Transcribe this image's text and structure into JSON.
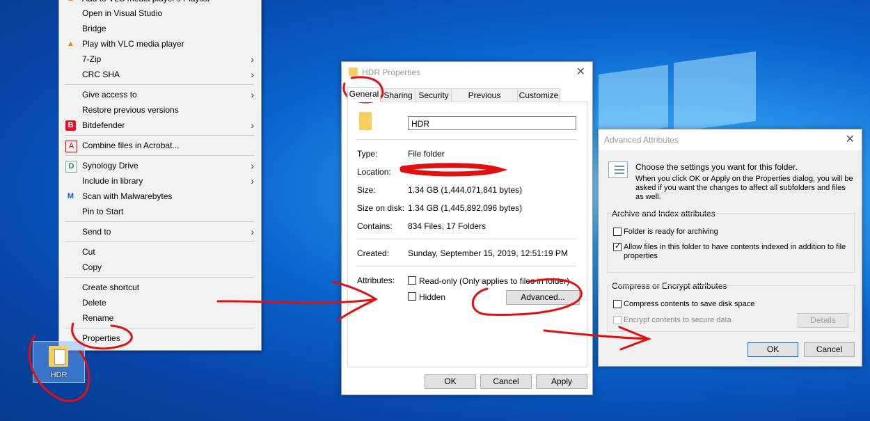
{
  "context_menu": {
    "items": [
      {
        "label": "Add to VLC media player's Playlist",
        "icon": "vlc-icon"
      },
      {
        "label": "Open in Visual Studio"
      },
      {
        "label": "Bridge"
      },
      {
        "label": "Play with VLC media player",
        "icon": "vlc-icon"
      },
      {
        "label": "7-Zip",
        "submenu": true
      },
      {
        "label": "CRC SHA",
        "submenu": true
      },
      {
        "label": "Give access to",
        "submenu": true
      },
      {
        "label": "Restore previous versions"
      },
      {
        "label": "Bitdefender",
        "submenu": true,
        "icon": "bitdefender-icon"
      },
      {
        "label": "Combine files in Acrobat...",
        "icon": "acrobat-icon"
      },
      {
        "label": "Synology Drive",
        "submenu": true,
        "icon": "synology-icon"
      },
      {
        "label": "Include in library",
        "submenu": true
      },
      {
        "label": "Scan with Malwarebytes",
        "icon": "malwarebytes-icon"
      },
      {
        "label": "Pin to Start"
      },
      {
        "label": "Send to",
        "submenu": true
      },
      {
        "label": "Cut"
      },
      {
        "label": "Copy"
      },
      {
        "label": "Create shortcut"
      },
      {
        "label": "Delete"
      },
      {
        "label": "Rename"
      },
      {
        "label": "Properties"
      }
    ],
    "arrow": "›",
    "vlc_glyph": "▲",
    "bd_glyph": "B",
    "syn_glyph": "D",
    "mb_glyph": "M",
    "acr_glyph": "A"
  },
  "desktop": {
    "icon_label": "HDR"
  },
  "properties": {
    "title": "HDR Properties",
    "close": "✕",
    "tabs": [
      "General",
      "Sharing",
      "Security",
      "Previous Versions",
      "Customize"
    ],
    "folder_name": "HDR",
    "fields": {
      "type_label": "Type:",
      "type_value": "File folder",
      "location_label": "Location:",
      "size_label": "Size:",
      "size_value": "1.34 GB (1,444,071,841 bytes)",
      "sizeondisk_label": "Size on disk:",
      "sizeondisk_value": "1.34 GB (1,445,892,096 bytes)",
      "contains_label": "Contains:",
      "contains_value": "834 Files, 17 Folders",
      "created_label": "Created:",
      "created_value": "Sunday, September 15, 2019, 12:51:19 PM",
      "attributes_label": "Attributes:"
    },
    "attributes": {
      "readonly": "Read-only (Only applies to files in folder)",
      "hidden": "Hidden",
      "advanced_button": "Advanced..."
    },
    "buttons": {
      "ok": "OK",
      "cancel": "Cancel",
      "apply": "Apply"
    }
  },
  "advanced": {
    "title": "Advanced Attributes",
    "close": "✕",
    "intro": "Choose the settings you want for this folder.",
    "intro2": "When you click OK or Apply on the Properties dialog, you will be asked if you want the changes to affect all subfolders and files as well.",
    "archive_group": "Archive and Index attributes",
    "archive_cb": "Folder is ready for archiving",
    "index_cb": "Allow files in this folder to have contents indexed in addition to file properties",
    "compress_group": "Compress or Encrypt attributes",
    "compress_cb": "Compress contents to save disk space",
    "encrypt_cb": "Encrypt contents to secure data",
    "details_button": "Details",
    "ok": "OK",
    "cancel": "Cancel"
  },
  "colors": {
    "annotation": "#e01010",
    "accent": "#0078d7",
    "folder": "#f5cf5b"
  }
}
